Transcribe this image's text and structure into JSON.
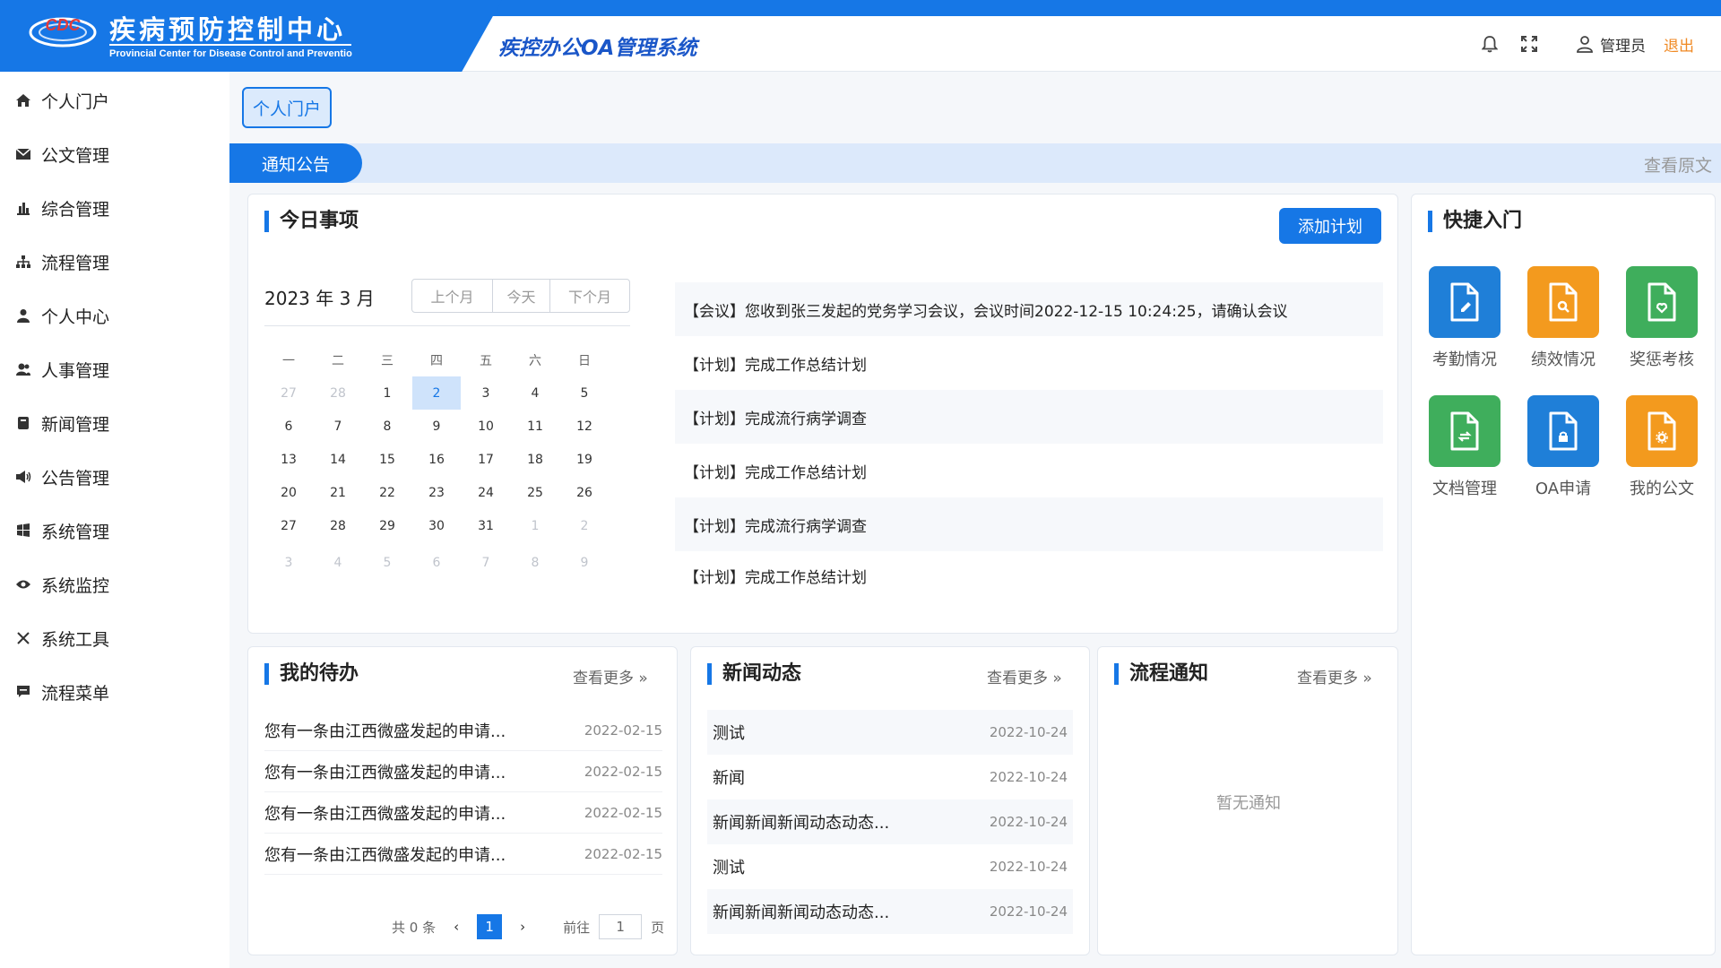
{
  "header": {
    "org_name_cn": "疾病预防控制中心",
    "org_name_en": "Provincial Center for Disease Control and Preventio",
    "logo_text": "CDC",
    "system_title": "疾控办公OA管理系统",
    "user_name": "管理员",
    "logout_label": "退出"
  },
  "sidebar": {
    "items": [
      {
        "label": "个人门户",
        "icon": "home-icon"
      },
      {
        "label": "公文管理",
        "icon": "envelope-icon"
      },
      {
        "label": "综合管理",
        "icon": "bar-chart-icon"
      },
      {
        "label": "流程管理",
        "icon": "sitemap-icon"
      },
      {
        "label": "个人中心",
        "icon": "user-icon"
      },
      {
        "label": "人事管理",
        "icon": "users-icon"
      },
      {
        "label": "新闻管理",
        "icon": "newspaper-icon"
      },
      {
        "label": "公告管理",
        "icon": "megaphone-icon"
      },
      {
        "label": "系统管理",
        "icon": "windows-icon"
      },
      {
        "label": "系统监控",
        "icon": "eye-icon"
      },
      {
        "label": "系统工具",
        "icon": "tools-icon"
      },
      {
        "label": "流程菜单",
        "icon": "chat-icon"
      }
    ]
  },
  "main": {
    "portal_tag": "个人门户",
    "notice_tab": "通知公告",
    "view_original": "查看原文"
  },
  "today": {
    "title": "今日事项",
    "add_plan": "添加计划",
    "calendar": {
      "title": "2023 年 3 月",
      "prev": "上个月",
      "today": "今天",
      "next": "下个月",
      "weekdays": [
        "一",
        "二",
        "三",
        "四",
        "五",
        "六",
        "日"
      ],
      "weeks": [
        [
          {
            "d": "27",
            "m": true
          },
          {
            "d": "28",
            "m": true
          },
          {
            "d": "1"
          },
          {
            "d": "2",
            "s": true
          },
          {
            "d": "3"
          },
          {
            "d": "4"
          },
          {
            "d": "5"
          }
        ],
        [
          {
            "d": "6"
          },
          {
            "d": "7"
          },
          {
            "d": "8"
          },
          {
            "d": "9"
          },
          {
            "d": "10"
          },
          {
            "d": "11"
          },
          {
            "d": "12"
          }
        ],
        [
          {
            "d": "13"
          },
          {
            "d": "14"
          },
          {
            "d": "15"
          },
          {
            "d": "16"
          },
          {
            "d": "17"
          },
          {
            "d": "18"
          },
          {
            "d": "19"
          }
        ],
        [
          {
            "d": "20"
          },
          {
            "d": "21"
          },
          {
            "d": "22"
          },
          {
            "d": "23"
          },
          {
            "d": "24"
          },
          {
            "d": "25"
          },
          {
            "d": "26"
          }
        ],
        [
          {
            "d": "27"
          },
          {
            "d": "28"
          },
          {
            "d": "29"
          },
          {
            "d": "30"
          },
          {
            "d": "31"
          },
          {
            "d": "1",
            "m": true
          },
          {
            "d": "2",
            "m": true
          }
        ],
        [
          {
            "d": "3",
            "m": true
          },
          {
            "d": "4",
            "m": true
          },
          {
            "d": "5",
            "m": true
          },
          {
            "d": "6",
            "m": true
          },
          {
            "d": "7",
            "m": true
          },
          {
            "d": "8",
            "m": true
          },
          {
            "d": "9",
            "m": true
          }
        ]
      ]
    },
    "events": [
      "【会议】您收到张三发起的党务学习会议，会议时间2022-12-15 10:24:25，请确认会议",
      "【计划】完成工作总结计划",
      "【计划】完成流行病学调查",
      "【计划】完成工作总结计划",
      "【计划】完成流行病学调查",
      "【计划】完成工作总结计划"
    ]
  },
  "quick": {
    "title": "快捷入门",
    "items": [
      {
        "label": "考勤情况",
        "color": "#1f7fd8",
        "icon": "doc-edit-icon"
      },
      {
        "label": "绩效情况",
        "color": "#f39a1e",
        "icon": "doc-search-icon"
      },
      {
        "label": "奖惩考核",
        "color": "#3fae5c",
        "icon": "doc-heart-icon"
      },
      {
        "label": "文档管理",
        "color": "#3fae5c",
        "icon": "doc-swap-icon"
      },
      {
        "label": "OA申请",
        "color": "#1f7fd8",
        "icon": "doc-lock-icon"
      },
      {
        "label": "我的公文",
        "color": "#f39a1e",
        "icon": "doc-gear-icon"
      }
    ]
  },
  "todo": {
    "title": "我的待办",
    "more": "查看更多",
    "rows": [
      {
        "text": "您有一条由江西微盛发起的申请...",
        "date": "2022-02-15"
      },
      {
        "text": "您有一条由江西微盛发起的申请...",
        "date": "2022-02-15"
      },
      {
        "text": "您有一条由江西微盛发起的申请...",
        "date": "2022-02-15"
      },
      {
        "text": "您有一条由江西微盛发起的申请...",
        "date": "2022-02-15"
      }
    ],
    "pager": {
      "total": "共 0 条",
      "current": "1",
      "goto": "前往",
      "goto_value": "1",
      "page": "页"
    }
  },
  "news": {
    "title": "新闻动态",
    "more": "查看更多",
    "rows": [
      {
        "text": "测试",
        "date": "2022-10-24"
      },
      {
        "text": "新闻",
        "date": "2022-10-24"
      },
      {
        "text": "新闻新闻新闻动态动态...",
        "date": "2022-10-24"
      },
      {
        "text": "测试",
        "date": "2022-10-24"
      },
      {
        "text": "新闻新闻新闻动态动态...",
        "date": "2022-10-24"
      }
    ]
  },
  "flow": {
    "title": "流程通知",
    "more": "查看更多",
    "empty": "暂无通知"
  },
  "colors": {
    "primary": "#1677e6",
    "accent_orange": "#f08a24",
    "tab_bg": "#dce9fb"
  }
}
